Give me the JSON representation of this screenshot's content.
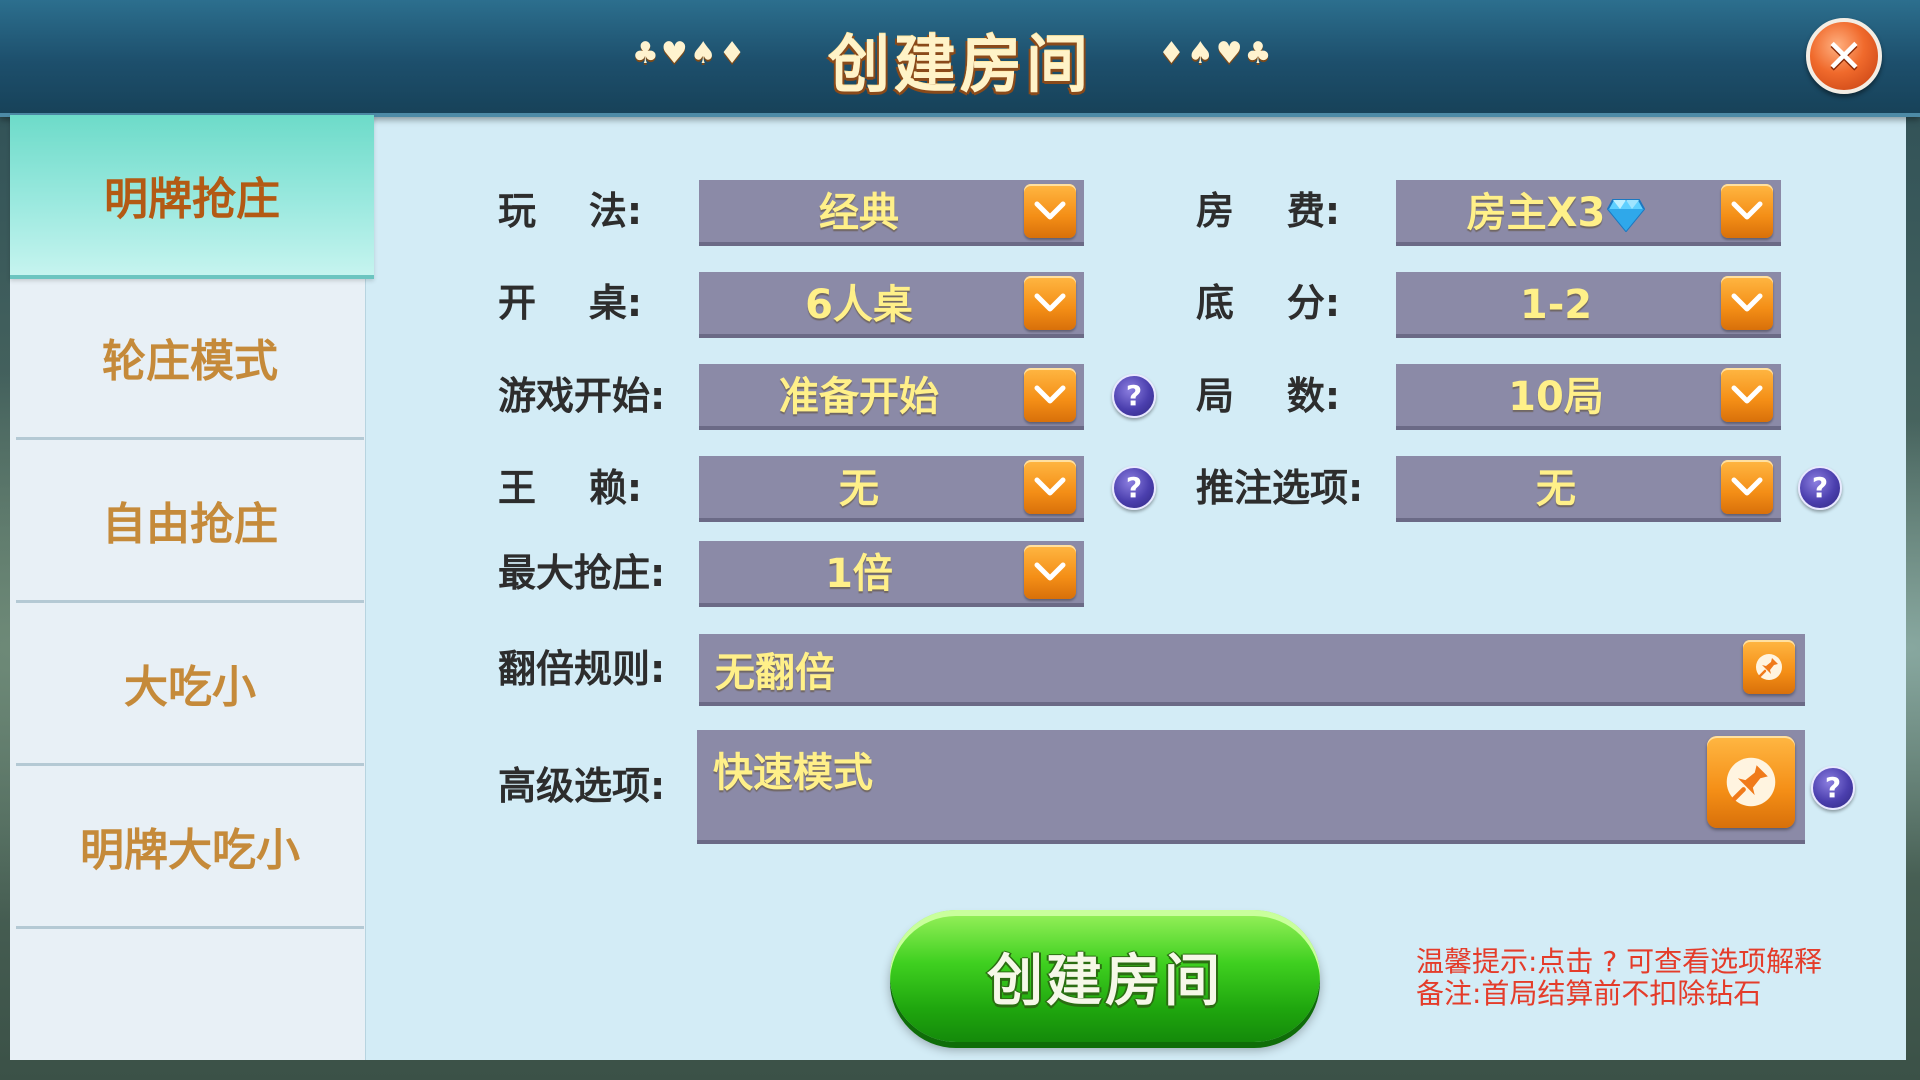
{
  "header": {
    "title": "创建房间",
    "suits_left": "♣♥♠♦",
    "suits_right": "♦♠♥♣",
    "close_icon": "✕"
  },
  "sidebar": {
    "tabs": [
      {
        "label": "明牌抢庄",
        "active": true
      },
      {
        "label": "轮庄模式",
        "active": false
      },
      {
        "label": "自由抢庄",
        "active": false
      },
      {
        "label": "大吃小",
        "active": false
      },
      {
        "label": "明牌大吃小",
        "active": false
      }
    ]
  },
  "form": {
    "play": {
      "label": "玩    法:",
      "value": "经典"
    },
    "fee": {
      "label": "房    费:",
      "value": "房主X3",
      "icon": "diamond-icon"
    },
    "table": {
      "label": "开    桌:",
      "value": "6人桌"
    },
    "base_score": {
      "label": "底    分:",
      "value": "1-2"
    },
    "game_start": {
      "label": "游戏开始:",
      "value": "准备开始"
    },
    "rounds": {
      "label": "局    数:",
      "value": "10局"
    },
    "wild": {
      "label": "王    赖:",
      "value": "无"
    },
    "push_bet": {
      "label": "推注选项:",
      "value": "无"
    },
    "max_grab": {
      "label": "最大抢庄:",
      "value": "1倍"
    },
    "double_rule": {
      "label": "翻倍规则:",
      "value": "无翻倍"
    },
    "advanced": {
      "label": "高级选项:",
      "value": "快速模式"
    }
  },
  "help_glyph": "?",
  "create_button": "创建房间",
  "tips": {
    "line1": "温馨提示:点击 ? 可查看选项解释",
    "line2": "备注:首局结算前不扣除钻石"
  },
  "colors": {
    "accent_orange": "#f48e16",
    "select_bg": "#8b8aa7",
    "value_text": "#fff089",
    "create_green": "#3fd020",
    "tip_red": "#e43c2a"
  }
}
